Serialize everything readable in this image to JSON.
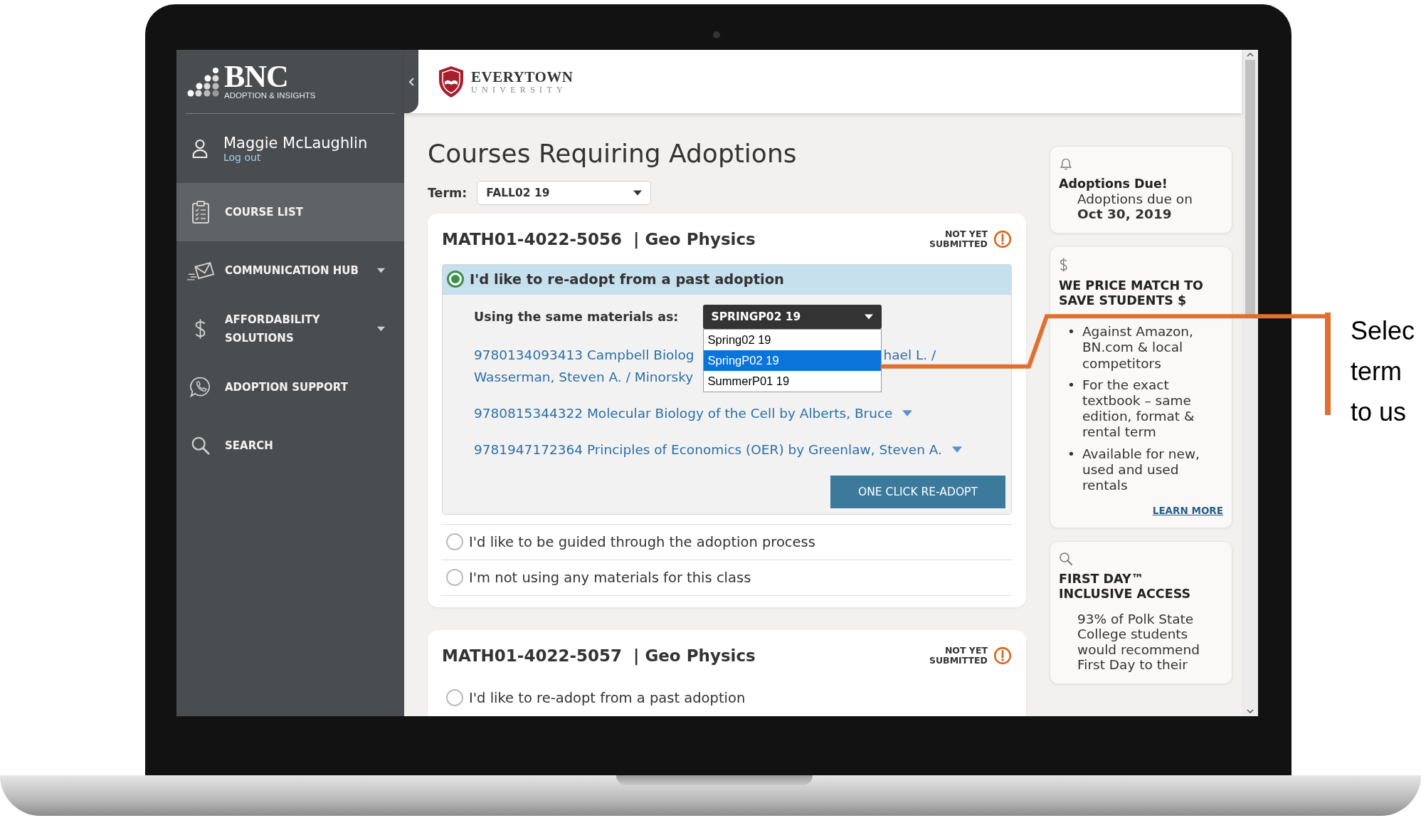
{
  "sidebar": {
    "brand": "BNC",
    "tagline": "ADOPTION & INSIGHTS",
    "user": {
      "name": "Maggie McLaughlin",
      "logout": "Log out"
    },
    "items": [
      {
        "label": "COURSE LIST",
        "selected": true,
        "has_submenu": false
      },
      {
        "label": "COMMUNICATION HUB",
        "selected": false,
        "has_submenu": true
      },
      {
        "label": "AFFORDABILITY SOLUTIONS",
        "selected": false,
        "has_submenu": true
      },
      {
        "label": "ADOPTION SUPPORT",
        "selected": false,
        "has_submenu": false
      },
      {
        "label": "SEARCH",
        "selected": false,
        "has_submenu": false
      }
    ]
  },
  "header": {
    "school_name": "EVERYTOWN",
    "school_subtitle": "UNIVERSITY"
  },
  "page_title": "Courses Requiring Adoptions",
  "term": {
    "label": "Term:",
    "value": "FALL02 19"
  },
  "courses": [
    {
      "title": "MATH01-4022-5056  | Geo Physics",
      "status": "NOT YET SUBMITTED",
      "options": [
        {
          "label": "I'd like to re-adopt from a past adoption",
          "selected": true,
          "materials": {
            "label": "Using the same materials as:",
            "dropdown": {
              "value": "SPRINGP02 19",
              "expanded": true,
              "options": [
                {
                  "label": "Spring02 19",
                  "selected": false
                },
                {
                  "label": "SpringP02 19",
                  "selected": true
                },
                {
                  "label": "SummerP01 19",
                  "selected": false
                }
              ]
            },
            "books": [
              {
                "kind": "covered",
                "line_1_start": "9780134093413 Campbell Biolog",
                "line_1_end": "hael L. /",
                "line_2": "Wasserman, Steven A. / Minorsky"
              },
              {
                "kind": "link",
                "text": "9780815344322 Molecular Biology of the Cell by Alberts, Bruce"
              },
              {
                "kind": "link",
                "text": "9781947172364 Principles of Economics (OER) by Greenlaw, Steven A."
              }
            ],
            "button": "ONE CLICK RE-ADOPT"
          }
        },
        {
          "label": "I'd like to be guided through the adoption process",
          "selected": false
        },
        {
          "label": "I'm not using any materials for this class",
          "selected": false
        }
      ]
    },
    {
      "title": "MATH01-4022-5057  | Geo Physics",
      "status": "NOT YET SUBMITTED",
      "options": [
        {
          "label": "I'd like to re-adopt from a past adoption",
          "selected": false
        }
      ]
    }
  ],
  "side_cards": [
    {
      "kind": "notice",
      "title": "Adoptions Due!",
      "text": "Adoptions due on",
      "date": "Oct 30, 2019"
    },
    {
      "kind": "list",
      "title": "WE PRICE MATCH TO SAVE STUDENTS $",
      "bullet_marker": "•",
      "bullets": [
        "Against Amazon, BN.com & local competitors",
        "For the exact textbook – same edition, format & rental term",
        "Available for new, used and used rentals"
      ],
      "link": "LEARN MORE"
    },
    {
      "kind": "paragraph",
      "title": "FIRST DAY™ INCLUSIVE ACCESS",
      "text": "93% of Polk State College students would recommend First Day to their"
    }
  ],
  "callout": {
    "lines": [
      "Selec",
      "term",
      "to us"
    ]
  }
}
